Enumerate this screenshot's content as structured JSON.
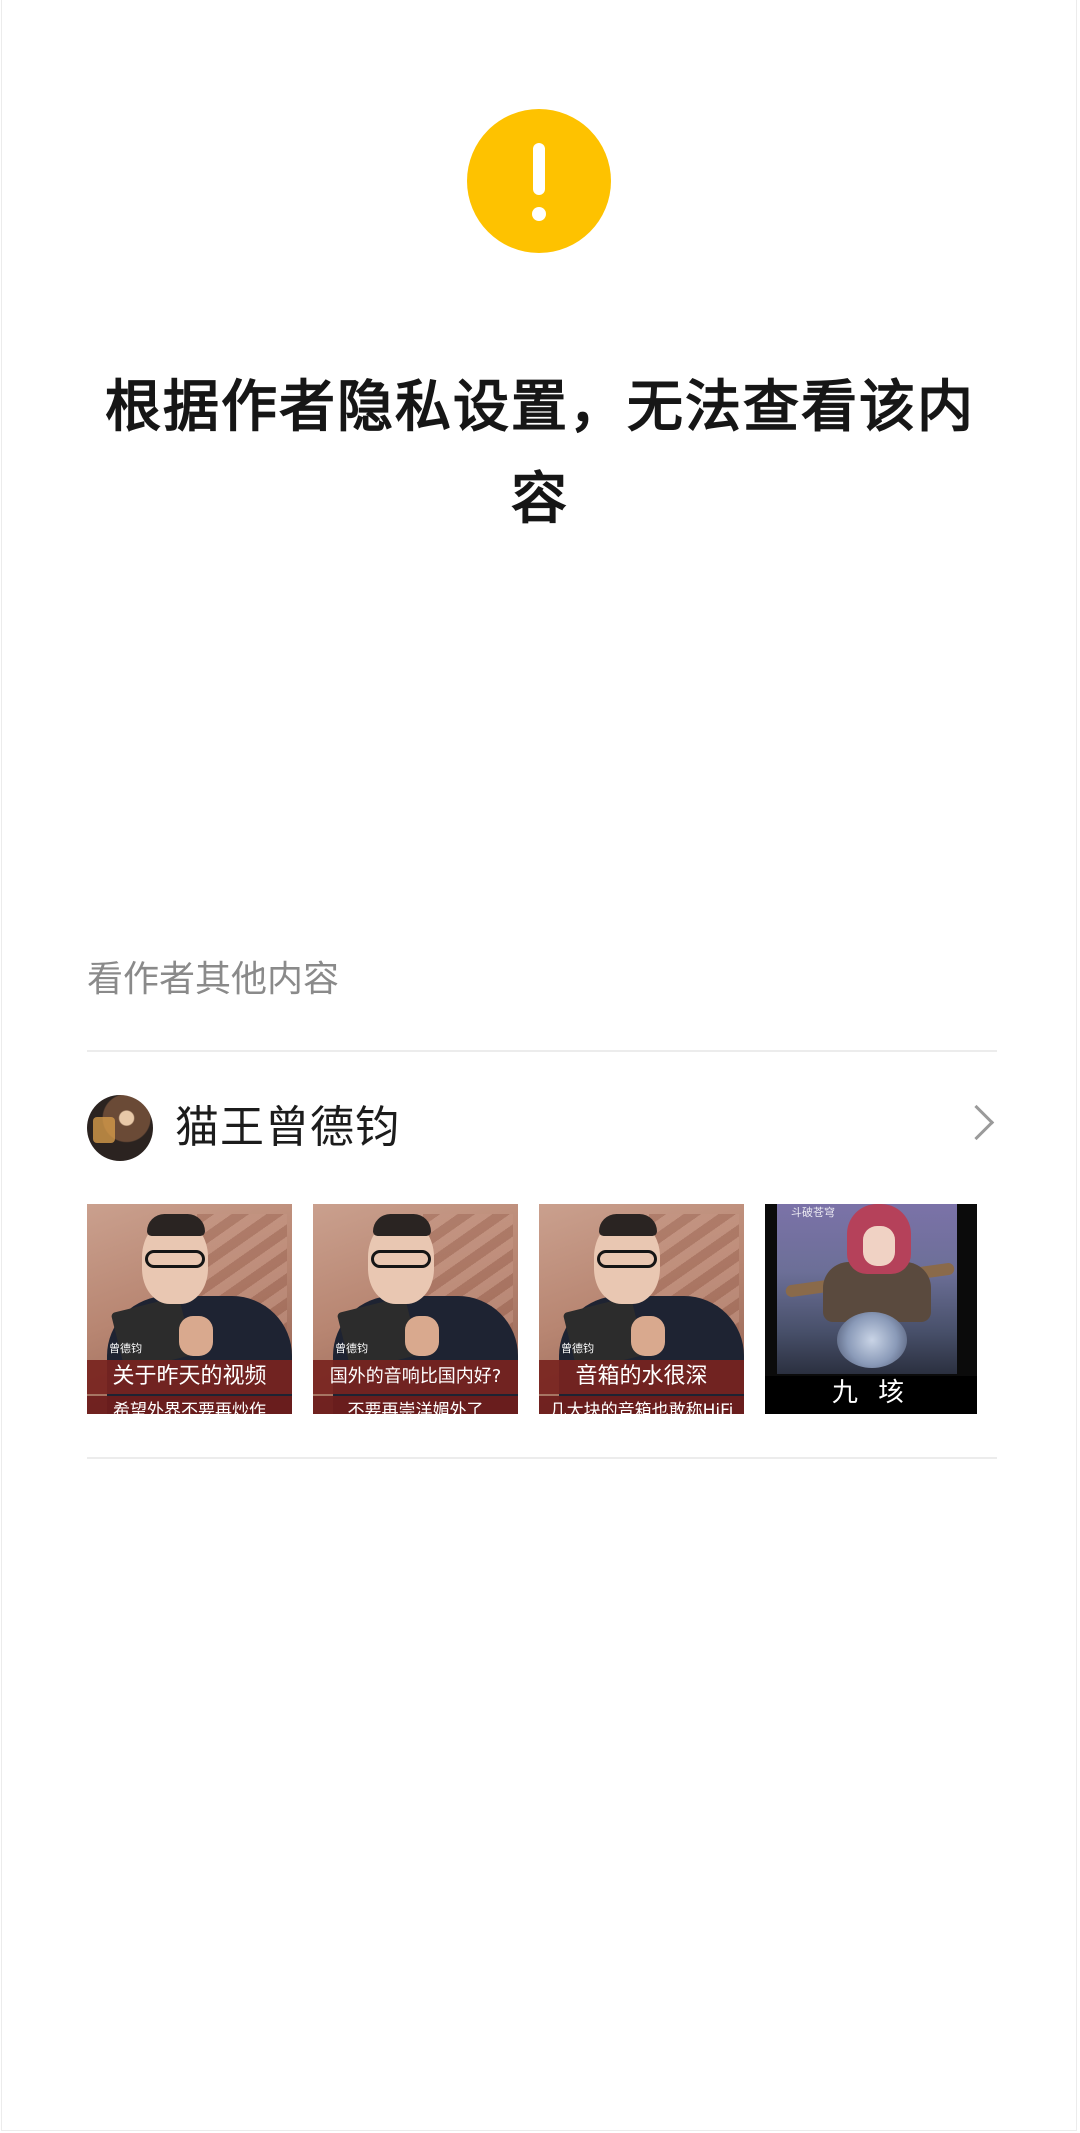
{
  "notice": {
    "icon": "warning-icon",
    "icon_color": "#FEC200",
    "message": "根据作者隐私设置，无法查看该内容"
  },
  "more_from_author": {
    "section_label": "看作者其他内容",
    "author_name": "猫王曾德钧",
    "chevron_icon": "chevron-right-icon",
    "items": [
      {
        "brand": "曾德钧",
        "caption": "关于昨天的视频",
        "subcaption": "希望外界不要再炒作"
      },
      {
        "brand": "曾德钧",
        "caption": "国外的音响比国内好?",
        "subcaption": "不要再崇洋媚外了"
      },
      {
        "brand": "曾德钧",
        "caption": "音箱的水很深",
        "subcaption": "几大块的音箱也敢称HiFi"
      },
      {
        "badge": "斗破苍穹",
        "caption": "九 垓"
      }
    ]
  }
}
